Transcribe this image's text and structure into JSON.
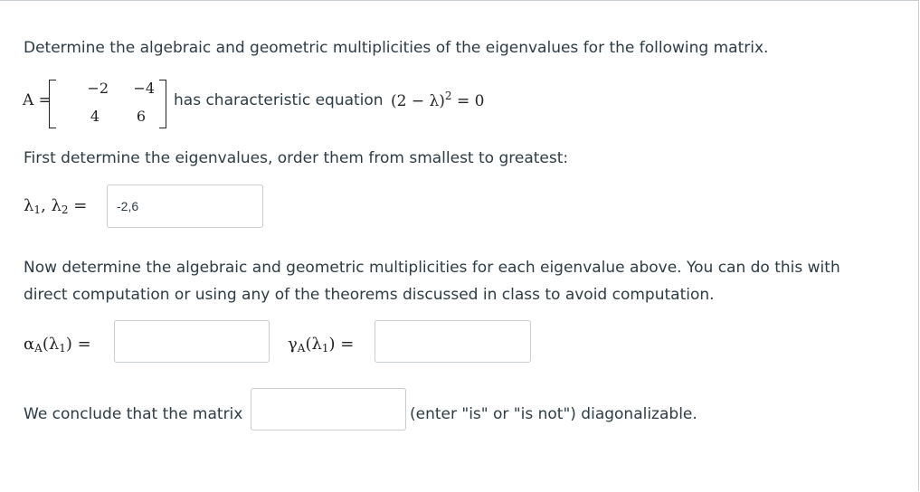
{
  "question": {
    "intro": "Determine the algebraic and geometric multiplicities of the eigenvalues for the following matrix.",
    "matrix_label": "A =",
    "matrix": [
      [
        "−2",
        "−4"
      ],
      [
        "4",
        "6"
      ]
    ],
    "char_eq_text": "has characteristic equation",
    "char_eq_math": "(2 − λ)",
    "char_eq_exp": "2",
    "char_eq_rhs": "= 0",
    "step1": "First determine the eigenvalues, order them from smallest to greatest:",
    "eig_label": "λ",
    "eig_sub1": "1",
    "eig_sep": ", λ",
    "eig_sub2": "2",
    "eig_eq": "=",
    "eigenvalues_value": "-2,6",
    "step2_line1": "Now determine the algebraic and geometric multiplicities for each eigenvalue above. You can do this with",
    "step2_line2": "direct computation or using any of the theorems discussed in class to avoid computation.",
    "alpha_label": "α",
    "alpha_sub": "A",
    "alpha_arg": "(λ",
    "alpha_arg_sub": "1",
    "alpha_close": ") =",
    "gamma_label": "γ",
    "gamma_sub": "A",
    "gamma_arg": "(λ",
    "gamma_arg_sub": "1",
    "gamma_close": ") =",
    "alpha_value": "",
    "gamma_value": "",
    "conclude_prefix": "We conclude that the matrix",
    "conclude_value": "",
    "conclude_suffix": "(enter \"is\" or \"is not\") diagonalizable."
  }
}
